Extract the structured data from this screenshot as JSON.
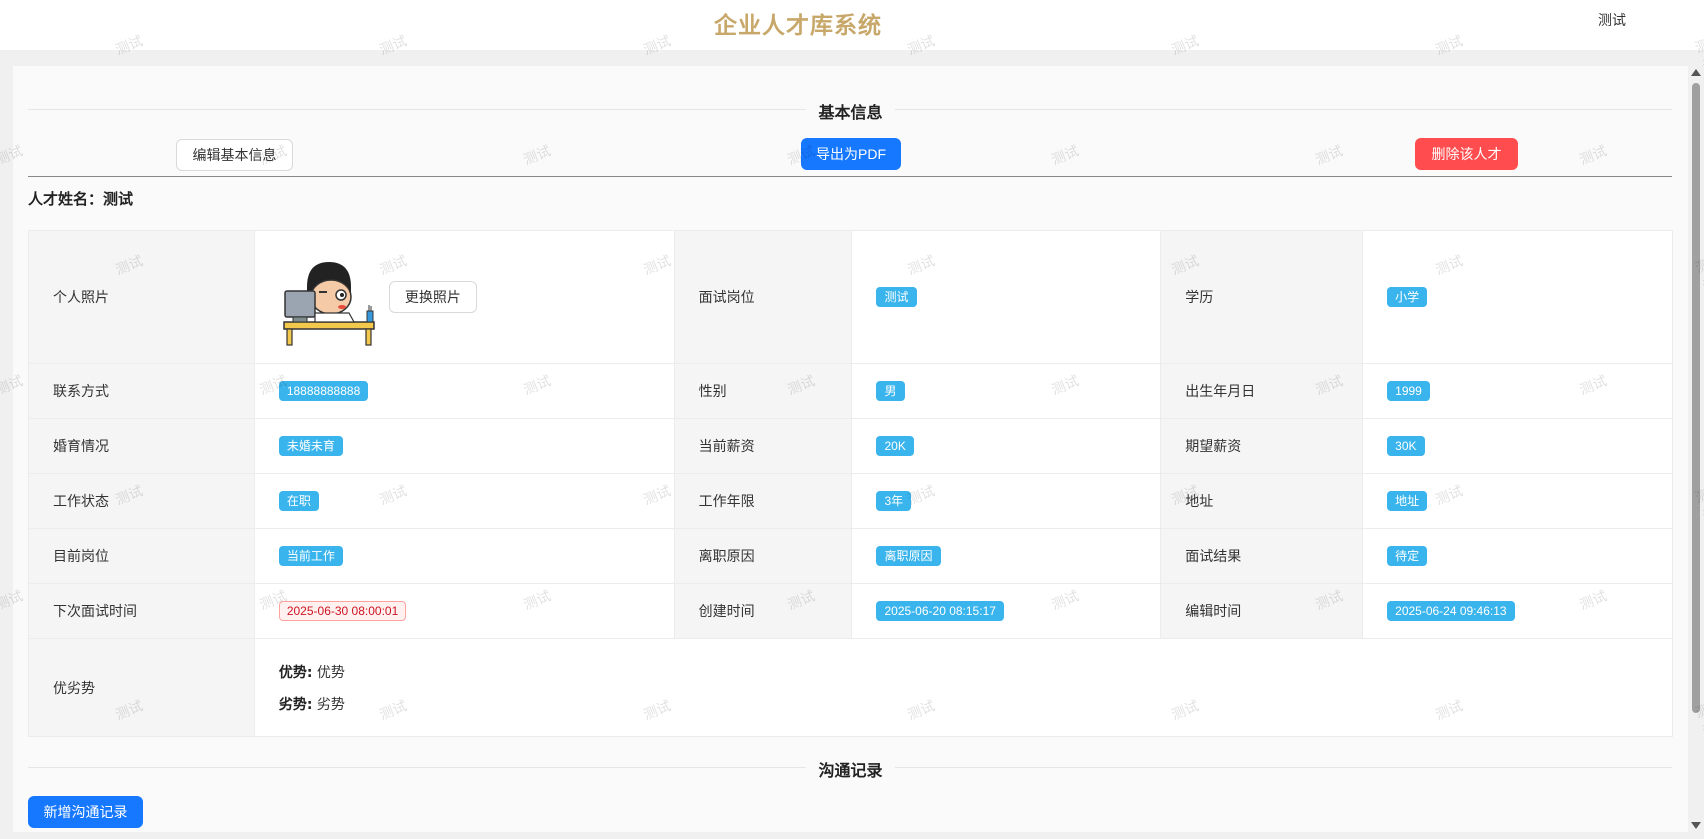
{
  "header": {
    "title": "企业人才库系统",
    "user": "测试"
  },
  "section_basic": {
    "title": "基本信息"
  },
  "actions": {
    "edit_basic": "编辑基本信息",
    "export_pdf": "导出为PDF",
    "delete_talent": "删除该人才"
  },
  "talent": {
    "name_label": "人才姓名：",
    "name": "测试"
  },
  "table": {
    "photo_label": "个人照片",
    "change_photo": "更换照片",
    "rows": [
      [
        {
          "label": "面试岗位",
          "value": "测试"
        },
        {
          "label": "学历",
          "value": "小学"
        }
      ],
      [
        {
          "label": "联系方式",
          "value": "18888888888"
        },
        {
          "label": "性别",
          "value": "男"
        },
        {
          "label": "出生年月日",
          "value": "1999"
        }
      ],
      [
        {
          "label": "婚育情况",
          "value": "未婚未育"
        },
        {
          "label": "当前薪资",
          "value": "20K"
        },
        {
          "label": "期望薪资",
          "value": "30K"
        }
      ],
      [
        {
          "label": "工作状态",
          "value": "在职"
        },
        {
          "label": "工作年限",
          "value": "3年"
        },
        {
          "label": "地址",
          "value": "地址"
        }
      ],
      [
        {
          "label": "目前岗位",
          "value": "当前工作"
        },
        {
          "label": "离职原因",
          "value": "离职原因"
        },
        {
          "label": "面试结果",
          "value": "待定"
        }
      ],
      [
        {
          "label": "下次面试时间",
          "value": "2025-06-30 08:00:01"
        },
        {
          "label": "创建时间",
          "value": "2025-06-20 08:15:17"
        },
        {
          "label": "编辑时间",
          "value": "2025-06-24 09:46:13"
        }
      ]
    ],
    "pros_cons": {
      "label": "优劣势",
      "strength_label": "优势:",
      "strength": "优势",
      "weakness_label": "劣势:",
      "weakness": "劣势"
    }
  },
  "section_comm": {
    "title": "沟通记录",
    "add_button": "新增沟通记录"
  },
  "watermark_text": "测试",
  "colors": {
    "brand_title": "#c8a86a",
    "primary": "#1677ff",
    "danger": "#ff4d4f",
    "tag": "#3ab4ec"
  }
}
